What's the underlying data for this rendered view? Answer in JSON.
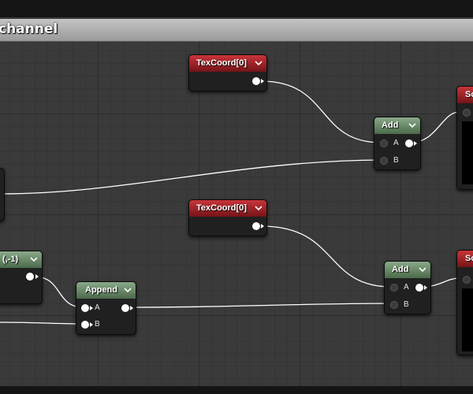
{
  "graph": {
    "title": "channel"
  },
  "nodes": {
    "texcoord_top": {
      "title": "TexCoord[0]"
    },
    "texcoord_bottom": {
      "title": "TexCoord[0]"
    },
    "add_top": {
      "title": "Add",
      "pin_a": "A",
      "pin_b": "B"
    },
    "add_bottom": {
      "title": "Add",
      "pin_a": "A",
      "pin_b": "B"
    },
    "append": {
      "title": "Append",
      "pin_a": "A",
      "pin_b": "B"
    },
    "constant_left": {
      "title": "(,-1)"
    },
    "sampler_top": {
      "title": "Sc"
    },
    "sampler_bottom": {
      "title": "Sc"
    }
  },
  "colors": {
    "texcoord_header": "#c9343a",
    "math_header": "#6a8a6a",
    "wire": "#ffffff"
  },
  "icons": {
    "collapse": "chevron-down-icon",
    "pin_connected": "filled-circle",
    "pin_unconnected": "hollow-circle"
  }
}
